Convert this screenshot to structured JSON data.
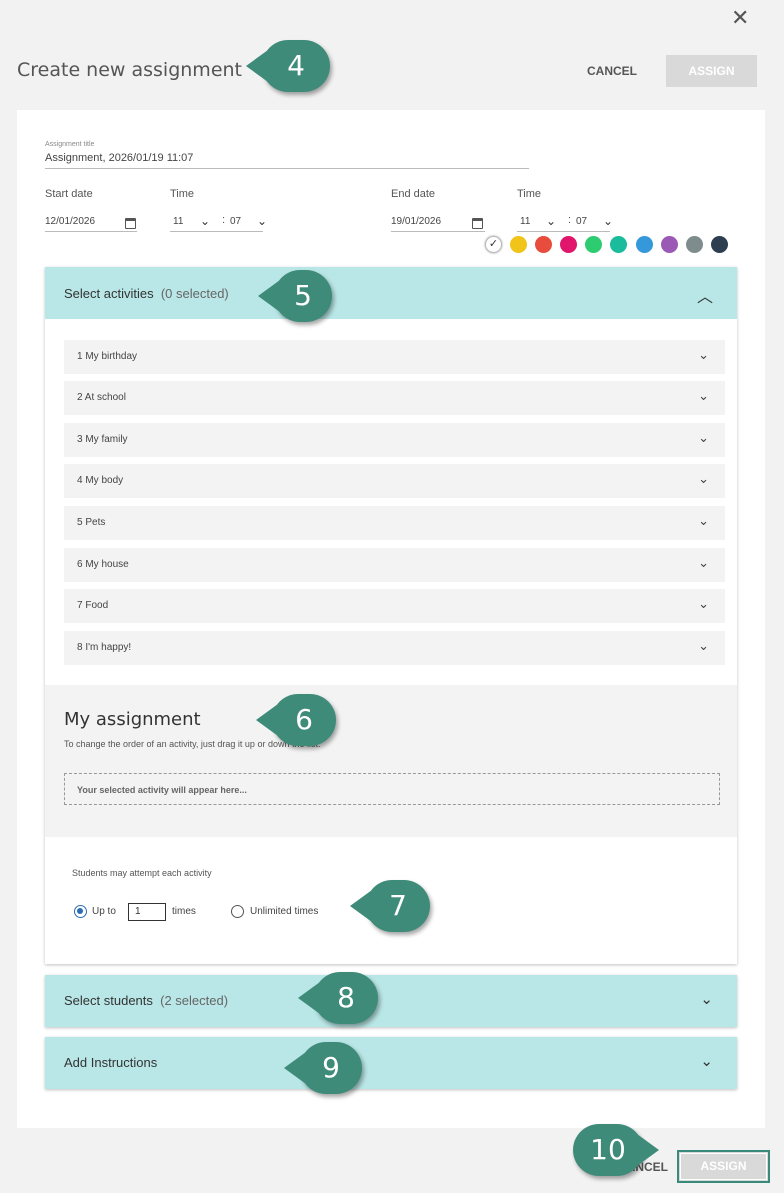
{
  "header": {
    "title": "Create new assignment",
    "cancel_label": "CANCEL",
    "assign_label": "ASSIGN",
    "close_glyph": "✕"
  },
  "form": {
    "title_label": "Assignment title",
    "title_value": "Assignment, 2026/01/19 11:07",
    "start_date_label": "Start date",
    "start_date_value": "12/01/2026",
    "start_time_label": "Time",
    "start_hour": "11",
    "start_minute": "07",
    "end_date_label": "End date",
    "end_date_value": "19/01/2026",
    "end_time_label": "Time",
    "end_hour": "11",
    "end_minute": "07",
    "colon": ":"
  },
  "colors": {
    "selected_check": "✓",
    "swatches": [
      "#ffffff",
      "#f0c419",
      "#e74c3c",
      "#e0156b",
      "#2ecc71",
      "#1abc9c",
      "#3498db",
      "#9b59b6",
      "#7f8c8d",
      "#2c3e50"
    ]
  },
  "activities": {
    "header": "Select activities",
    "count": "(0 selected)",
    "items": [
      "1 My birthday",
      "2 At school",
      "3 My family",
      "4 My body",
      "5 Pets",
      "6 My house",
      "7 Food",
      "8 I'm happy!"
    ]
  },
  "my_assignment": {
    "heading": "My assignment",
    "description": "To change the order of an activity, just drag it up or down the list.",
    "dropzone": "Your selected activity will appear here..."
  },
  "attempts": {
    "label": "Students may attempt each activity",
    "up_to": "Up to",
    "value": "1",
    "times": "times",
    "unlimited": "Unlimited times"
  },
  "students": {
    "header": "Select students",
    "count": "(2 selected)"
  },
  "instructions": {
    "header": "Add Instructions"
  },
  "footer": {
    "cancel_label": "CANCEL",
    "assign_label": "ASSIGN"
  },
  "callouts": [
    "4",
    "5",
    "6",
    "7",
    "8",
    "9",
    "10"
  ]
}
